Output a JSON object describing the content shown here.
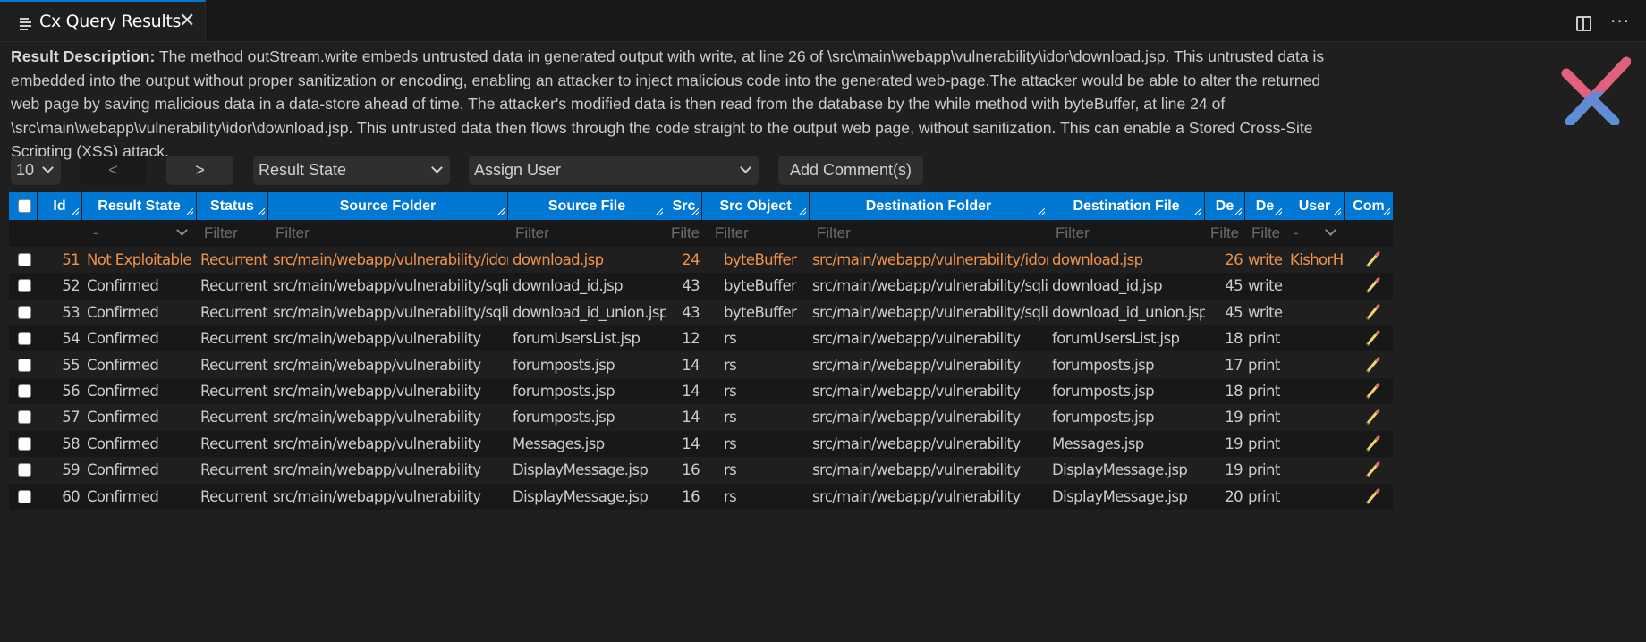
{
  "tab": {
    "title": "Cx Query Results",
    "icon": "list-icon",
    "close_icon": "close-icon"
  },
  "actions": {
    "split_icon": "split-editor-icon",
    "more_label": "···"
  },
  "description": {
    "label": "Result Description:",
    "text": " The method outStream.write embeds untrusted data in generated output with write, at line 26 of \\src\\main\\webapp\\vulnerability\\idor\\download.jsp. This untrusted data is embedded into the output without proper sanitization or encoding, enabling an attacker to inject malicious code into the generated web-page.The attacker would be able to alter the returned web page by saving malicious data in a data-store ahead of time. The attacker's modified data is then read from the database by the while method with byteBuffer, at line 24 of \\src\\main\\webapp\\vulnerability\\idor\\download.jsp. This untrusted data then flows through the code straight to the output web page, without sanitization. This can enable a Stored Cross-Site Scripting (XSS) attack."
  },
  "logo": {
    "name": "checkmarx-logo",
    "colors": {
      "top": "#e0607e",
      "bottom": "#5b8fd9"
    }
  },
  "toolbar": {
    "page_size": "10",
    "prev_label": "<",
    "next_label": ">",
    "result_state_select": "Result State",
    "assign_user_select": "Assign User",
    "add_comment_label": "Add Comment(s)"
  },
  "colors": {
    "header_bg": "#0078d4",
    "highlight_text": "#f0924a",
    "accent": "#0078d4"
  },
  "table": {
    "columns": [
      "Id",
      "Result State",
      "Status",
      "Source Folder",
      "Source File",
      "Src",
      "Src Object",
      "Destination Folder",
      "Destination File",
      "De",
      "De",
      "User",
      "Com"
    ],
    "filters": {
      "result_state": "-",
      "status": "Filter",
      "source_folder": "Filter",
      "source_file": "Filter",
      "src": "Filte",
      "src_object": "Filter",
      "destination_folder": "Filter",
      "destination_file": "Filter",
      "dest_line": "Filte",
      "dest_object": "Filte",
      "user": "-"
    },
    "rows": [
      {
        "id": "51",
        "result_state": "Not Exploitable",
        "status": "Recurrent",
        "source_folder": "src/main/webapp/vulnerability/idor",
        "source_file": "download.jsp",
        "src": "24",
        "src_object": "byteBuffer",
        "destination_folder": "src/main/webapp/vulnerability/idor",
        "destination_file": "download.jsp",
        "dest_line": "26",
        "dest_object": "write",
        "user": "KishorH",
        "highlight": true
      },
      {
        "id": "52",
        "result_state": "Confirmed",
        "status": "Recurrent",
        "source_folder": "src/main/webapp/vulnerability/sqli",
        "source_file": "download_id.jsp",
        "src": "43",
        "src_object": "byteBuffer",
        "destination_folder": "src/main/webapp/vulnerability/sqli",
        "destination_file": "download_id.jsp",
        "dest_line": "45",
        "dest_object": "write",
        "user": ""
      },
      {
        "id": "53",
        "result_state": "Confirmed",
        "status": "Recurrent",
        "source_folder": "src/main/webapp/vulnerability/sqli",
        "source_file": "download_id_union.jsp",
        "src": "43",
        "src_object": "byteBuffer",
        "destination_folder": "src/main/webapp/vulnerability/sqli",
        "destination_file": "download_id_union.jsp",
        "dest_line": "45",
        "dest_object": "write",
        "user": ""
      },
      {
        "id": "54",
        "result_state": "Confirmed",
        "status": "Recurrent",
        "source_folder": "src/main/webapp/vulnerability",
        "source_file": "forumUsersList.jsp",
        "src": "12",
        "src_object": "rs",
        "destination_folder": "src/main/webapp/vulnerability",
        "destination_file": "forumUsersList.jsp",
        "dest_line": "18",
        "dest_object": "print",
        "user": ""
      },
      {
        "id": "55",
        "result_state": "Confirmed",
        "status": "Recurrent",
        "source_folder": "src/main/webapp/vulnerability",
        "source_file": "forumposts.jsp",
        "src": "14",
        "src_object": "rs",
        "destination_folder": "src/main/webapp/vulnerability",
        "destination_file": "forumposts.jsp",
        "dest_line": "17",
        "dest_object": "print",
        "user": ""
      },
      {
        "id": "56",
        "result_state": "Confirmed",
        "status": "Recurrent",
        "source_folder": "src/main/webapp/vulnerability",
        "source_file": "forumposts.jsp",
        "src": "14",
        "src_object": "rs",
        "destination_folder": "src/main/webapp/vulnerability",
        "destination_file": "forumposts.jsp",
        "dest_line": "18",
        "dest_object": "print",
        "user": ""
      },
      {
        "id": "57",
        "result_state": "Confirmed",
        "status": "Recurrent",
        "source_folder": "src/main/webapp/vulnerability",
        "source_file": "forumposts.jsp",
        "src": "14",
        "src_object": "rs",
        "destination_folder": "src/main/webapp/vulnerability",
        "destination_file": "forumposts.jsp",
        "dest_line": "19",
        "dest_object": "print",
        "user": ""
      },
      {
        "id": "58",
        "result_state": "Confirmed",
        "status": "Recurrent",
        "source_folder": "src/main/webapp/vulnerability",
        "source_file": "Messages.jsp",
        "src": "14",
        "src_object": "rs",
        "destination_folder": "src/main/webapp/vulnerability",
        "destination_file": "Messages.jsp",
        "dest_line": "19",
        "dest_object": "print",
        "user": ""
      },
      {
        "id": "59",
        "result_state": "Confirmed",
        "status": "Recurrent",
        "source_folder": "src/main/webapp/vulnerability",
        "source_file": "DisplayMessage.jsp",
        "src": "16",
        "src_object": "rs",
        "destination_folder": "src/main/webapp/vulnerability",
        "destination_file": "DisplayMessage.jsp",
        "dest_line": "19",
        "dest_object": "print",
        "user": ""
      },
      {
        "id": "60",
        "result_state": "Confirmed",
        "status": "Recurrent",
        "source_folder": "src/main/webapp/vulnerability",
        "source_file": "DisplayMessage.jsp",
        "src": "16",
        "src_object": "rs",
        "destination_folder": "src/main/webapp/vulnerability",
        "destination_file": "DisplayMessage.jsp",
        "dest_line": "20",
        "dest_object": "print",
        "user": ""
      }
    ]
  }
}
